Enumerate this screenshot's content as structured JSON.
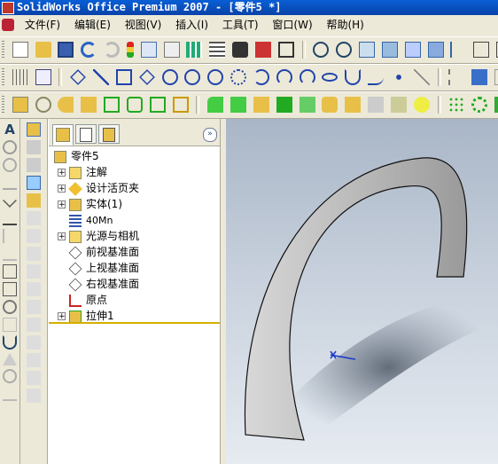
{
  "title": "SolidWorks Office Premium 2007 - [零件5 *]",
  "menu": [
    "文件(F)",
    "编辑(E)",
    "视图(V)",
    "插入(I)",
    "工具(T)",
    "窗口(W)",
    "帮助(H)"
  ],
  "feature_tree": {
    "root": "零件5",
    "items": [
      {
        "label": "注解",
        "expandable": true,
        "icon": "annotation-icon"
      },
      {
        "label": "设计活页夹",
        "expandable": true,
        "icon": "design-binder-icon"
      },
      {
        "label": "实体(1)",
        "expandable": true,
        "icon": "solid-body-icon"
      },
      {
        "label": "40Mn",
        "expandable": false,
        "icon": "material-icon"
      },
      {
        "label": "光源与相机",
        "expandable": true,
        "icon": "lights-cameras-icon"
      },
      {
        "label": "前视基准面",
        "expandable": false,
        "icon": "plane-icon"
      },
      {
        "label": "上视基准面",
        "expandable": false,
        "icon": "plane-icon"
      },
      {
        "label": "右视基准面",
        "expandable": false,
        "icon": "plane-icon"
      },
      {
        "label": "原点",
        "expandable": false,
        "icon": "origin-icon"
      },
      {
        "label": "拉伸1",
        "expandable": true,
        "icon": "extrude-icon"
      }
    ]
  },
  "expand_label": "»",
  "colors": {
    "titlebar": "#0842a8",
    "selection_divider": "#d4b000",
    "model": "#bfbfbf"
  }
}
